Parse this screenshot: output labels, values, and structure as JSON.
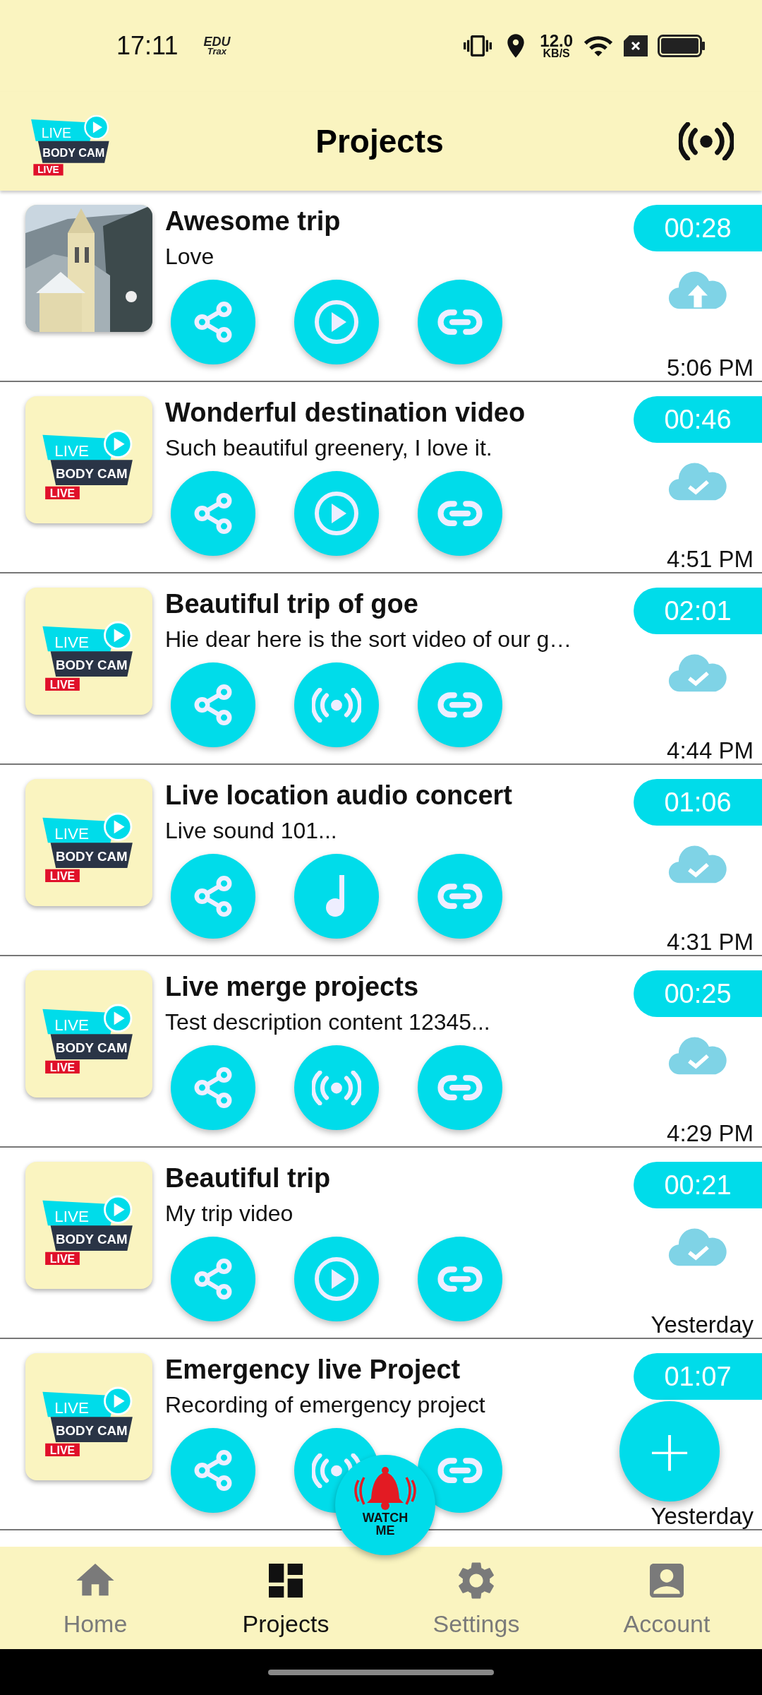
{
  "status_bar": {
    "time": "17:11",
    "notification": [
      "EDU",
      "Trax"
    ],
    "speed": [
      "12.0",
      "KB/S"
    ]
  },
  "header": {
    "title": "Projects",
    "logo": [
      "LIVE",
      "BODY CAM",
      "LIVE"
    ]
  },
  "projects": [
    {
      "title": "Awesome trip",
      "subtitle": "Love",
      "action": {
        "kind": "play"
      },
      "duration": "00:28",
      "cloud": {
        "kind": "upload"
      },
      "time": "5:06 PM"
    },
    {
      "thumbnail": {
        "kind": "logo",
        "texts": [
          "LIVE",
          "BODY CAM",
          "LIVE"
        ]
      },
      "title": "Wonderful destination video",
      "subtitle": "Such beautiful greenery, I love it.",
      "action": {
        "kind": "play"
      },
      "duration": "00:46",
      "cloud": {
        "kind": "synced"
      },
      "time": "4:51 PM"
    },
    {
      "thumbnail": {
        "kind": "logo",
        "texts": [
          "LIVE",
          "BODY CAM",
          "LIVE"
        ]
      },
      "title": "Beautiful trip of goe",
      "subtitle": "Hie dear here is the sort video of our g…",
      "action": {
        "kind": "live"
      },
      "duration": "02:01",
      "cloud": {
        "kind": "synced"
      },
      "time": "4:44 PM"
    },
    {
      "thumbnail": {
        "kind": "logo",
        "texts": [
          "LIVE",
          "BODY CAM",
          "LIVE"
        ]
      },
      "title": "Live location audio concert",
      "subtitle": "Live sound 101...",
      "action": {
        "kind": "audio"
      },
      "duration": "01:06",
      "cloud": {
        "kind": "synced"
      },
      "time": "4:31 PM"
    },
    {
      "thumbnail": {
        "kind": "logo",
        "texts": [
          "LIVE",
          "BODY CAM",
          "LIVE"
        ]
      },
      "title": "Live merge projects",
      "subtitle": "Test description content 12345...",
      "action": {
        "kind": "live"
      },
      "duration": "00:25",
      "cloud": {
        "kind": "synced"
      },
      "time": "4:29 PM"
    },
    {
      "thumbnail": {
        "kind": "logo",
        "texts": [
          "LIVE",
          "BODY CAM",
          "LIVE"
        ]
      },
      "title": "Beautiful trip",
      "subtitle": "My trip video",
      "action": {
        "kind": "play"
      },
      "duration": "00:21",
      "cloud": {
        "kind": "synced"
      },
      "time": "Yesterday"
    },
    {
      "thumbnail": {
        "kind": "logo",
        "texts": [
          "LIVE",
          "BODY CAM",
          "LIVE"
        ]
      },
      "title": "Emergency live Project",
      "subtitle": "Recording of emergency project",
      "action": {
        "kind": "live"
      },
      "duration": "01:07",
      "time": "Yesterday"
    }
  ],
  "watch_button": {
    "label": "WATCH ME"
  },
  "fab": {
    "label": "+"
  },
  "nav": [
    {
      "label": "Home",
      "kind": "home",
      "selected": false
    },
    {
      "label": "Projects",
      "kind": "dashboard",
      "selected": true
    },
    {
      "label": "Settings",
      "kind": "settings",
      "selected": false
    },
    {
      "label": "Account",
      "kind": "account",
      "selected": false
    }
  ]
}
